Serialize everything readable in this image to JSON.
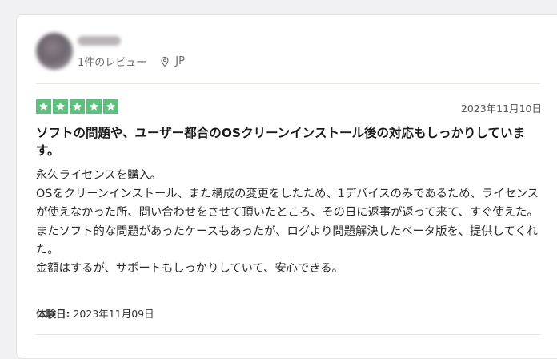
{
  "reviewer": {
    "review_count": "1件のレビュー",
    "country": "JP"
  },
  "rating": {
    "stars": 5,
    "max": 5,
    "star_color": "#00b67a"
  },
  "review": {
    "date": "2023年11月10日",
    "title": "ソフトの問題や、ユーザー都合のOSクリーンインストール後の対応もしっかりしています。",
    "body": [
      "永久ライセンスを購入。",
      "OSをクリーンインストール、また構成の変更をしたため、1デバイスのみであるため、ライセンスが使えなかった所、問い合わせをさせて頂いたところ、その日に返事が返って来て、すぐ使えた。",
      "またソフト的な問題があったケースもあったが、ログより問題解決したベータ版を、提供してくれた。",
      "金額はするが、サポートもしっかりしていて、安心できる。"
    ],
    "experience_label": "体験日:",
    "experience_date": "2023年11月09日"
  }
}
